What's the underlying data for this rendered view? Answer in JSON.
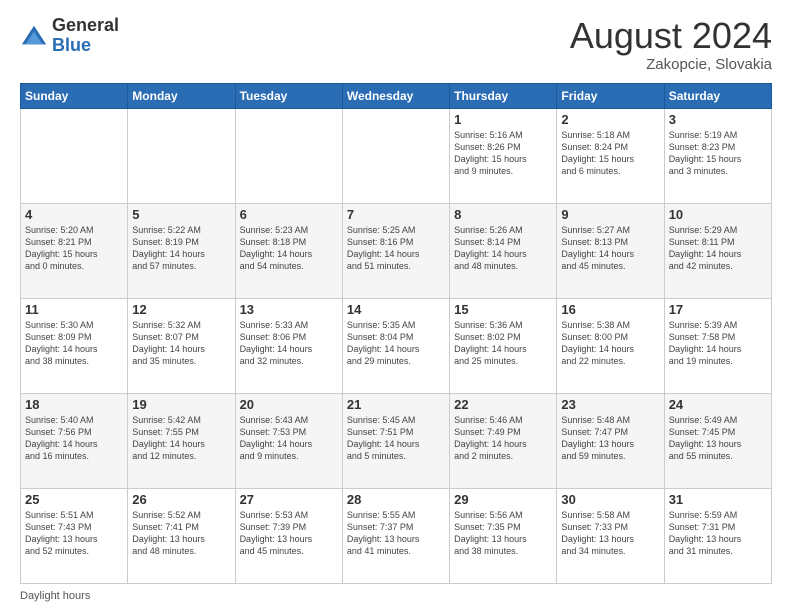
{
  "header": {
    "logo": {
      "general": "General",
      "blue": "Blue"
    },
    "title": "August 2024",
    "location": "Zakopcie, Slovakia"
  },
  "weekdays": [
    "Sunday",
    "Monday",
    "Tuesday",
    "Wednesday",
    "Thursday",
    "Friday",
    "Saturday"
  ],
  "weeks": [
    [
      {
        "day": "",
        "info": ""
      },
      {
        "day": "",
        "info": ""
      },
      {
        "day": "",
        "info": ""
      },
      {
        "day": "",
        "info": ""
      },
      {
        "day": "1",
        "info": "Sunrise: 5:16 AM\nSunset: 8:26 PM\nDaylight: 15 hours\nand 9 minutes."
      },
      {
        "day": "2",
        "info": "Sunrise: 5:18 AM\nSunset: 8:24 PM\nDaylight: 15 hours\nand 6 minutes."
      },
      {
        "day": "3",
        "info": "Sunrise: 5:19 AM\nSunset: 8:23 PM\nDaylight: 15 hours\nand 3 minutes."
      }
    ],
    [
      {
        "day": "4",
        "info": "Sunrise: 5:20 AM\nSunset: 8:21 PM\nDaylight: 15 hours\nand 0 minutes."
      },
      {
        "day": "5",
        "info": "Sunrise: 5:22 AM\nSunset: 8:19 PM\nDaylight: 14 hours\nand 57 minutes."
      },
      {
        "day": "6",
        "info": "Sunrise: 5:23 AM\nSunset: 8:18 PM\nDaylight: 14 hours\nand 54 minutes."
      },
      {
        "day": "7",
        "info": "Sunrise: 5:25 AM\nSunset: 8:16 PM\nDaylight: 14 hours\nand 51 minutes."
      },
      {
        "day": "8",
        "info": "Sunrise: 5:26 AM\nSunset: 8:14 PM\nDaylight: 14 hours\nand 48 minutes."
      },
      {
        "day": "9",
        "info": "Sunrise: 5:27 AM\nSunset: 8:13 PM\nDaylight: 14 hours\nand 45 minutes."
      },
      {
        "day": "10",
        "info": "Sunrise: 5:29 AM\nSunset: 8:11 PM\nDaylight: 14 hours\nand 42 minutes."
      }
    ],
    [
      {
        "day": "11",
        "info": "Sunrise: 5:30 AM\nSunset: 8:09 PM\nDaylight: 14 hours\nand 38 minutes."
      },
      {
        "day": "12",
        "info": "Sunrise: 5:32 AM\nSunset: 8:07 PM\nDaylight: 14 hours\nand 35 minutes."
      },
      {
        "day": "13",
        "info": "Sunrise: 5:33 AM\nSunset: 8:06 PM\nDaylight: 14 hours\nand 32 minutes."
      },
      {
        "day": "14",
        "info": "Sunrise: 5:35 AM\nSunset: 8:04 PM\nDaylight: 14 hours\nand 29 minutes."
      },
      {
        "day": "15",
        "info": "Sunrise: 5:36 AM\nSunset: 8:02 PM\nDaylight: 14 hours\nand 25 minutes."
      },
      {
        "day": "16",
        "info": "Sunrise: 5:38 AM\nSunset: 8:00 PM\nDaylight: 14 hours\nand 22 minutes."
      },
      {
        "day": "17",
        "info": "Sunrise: 5:39 AM\nSunset: 7:58 PM\nDaylight: 14 hours\nand 19 minutes."
      }
    ],
    [
      {
        "day": "18",
        "info": "Sunrise: 5:40 AM\nSunset: 7:56 PM\nDaylight: 14 hours\nand 16 minutes."
      },
      {
        "day": "19",
        "info": "Sunrise: 5:42 AM\nSunset: 7:55 PM\nDaylight: 14 hours\nand 12 minutes."
      },
      {
        "day": "20",
        "info": "Sunrise: 5:43 AM\nSunset: 7:53 PM\nDaylight: 14 hours\nand 9 minutes."
      },
      {
        "day": "21",
        "info": "Sunrise: 5:45 AM\nSunset: 7:51 PM\nDaylight: 14 hours\nand 5 minutes."
      },
      {
        "day": "22",
        "info": "Sunrise: 5:46 AM\nSunset: 7:49 PM\nDaylight: 14 hours\nand 2 minutes."
      },
      {
        "day": "23",
        "info": "Sunrise: 5:48 AM\nSunset: 7:47 PM\nDaylight: 13 hours\nand 59 minutes."
      },
      {
        "day": "24",
        "info": "Sunrise: 5:49 AM\nSunset: 7:45 PM\nDaylight: 13 hours\nand 55 minutes."
      }
    ],
    [
      {
        "day": "25",
        "info": "Sunrise: 5:51 AM\nSunset: 7:43 PM\nDaylight: 13 hours\nand 52 minutes."
      },
      {
        "day": "26",
        "info": "Sunrise: 5:52 AM\nSunset: 7:41 PM\nDaylight: 13 hours\nand 48 minutes."
      },
      {
        "day": "27",
        "info": "Sunrise: 5:53 AM\nSunset: 7:39 PM\nDaylight: 13 hours\nand 45 minutes."
      },
      {
        "day": "28",
        "info": "Sunrise: 5:55 AM\nSunset: 7:37 PM\nDaylight: 13 hours\nand 41 minutes."
      },
      {
        "day": "29",
        "info": "Sunrise: 5:56 AM\nSunset: 7:35 PM\nDaylight: 13 hours\nand 38 minutes."
      },
      {
        "day": "30",
        "info": "Sunrise: 5:58 AM\nSunset: 7:33 PM\nDaylight: 13 hours\nand 34 minutes."
      },
      {
        "day": "31",
        "info": "Sunrise: 5:59 AM\nSunset: 7:31 PM\nDaylight: 13 hours\nand 31 minutes."
      }
    ]
  ],
  "footer": {
    "daylight_label": "Daylight hours"
  }
}
